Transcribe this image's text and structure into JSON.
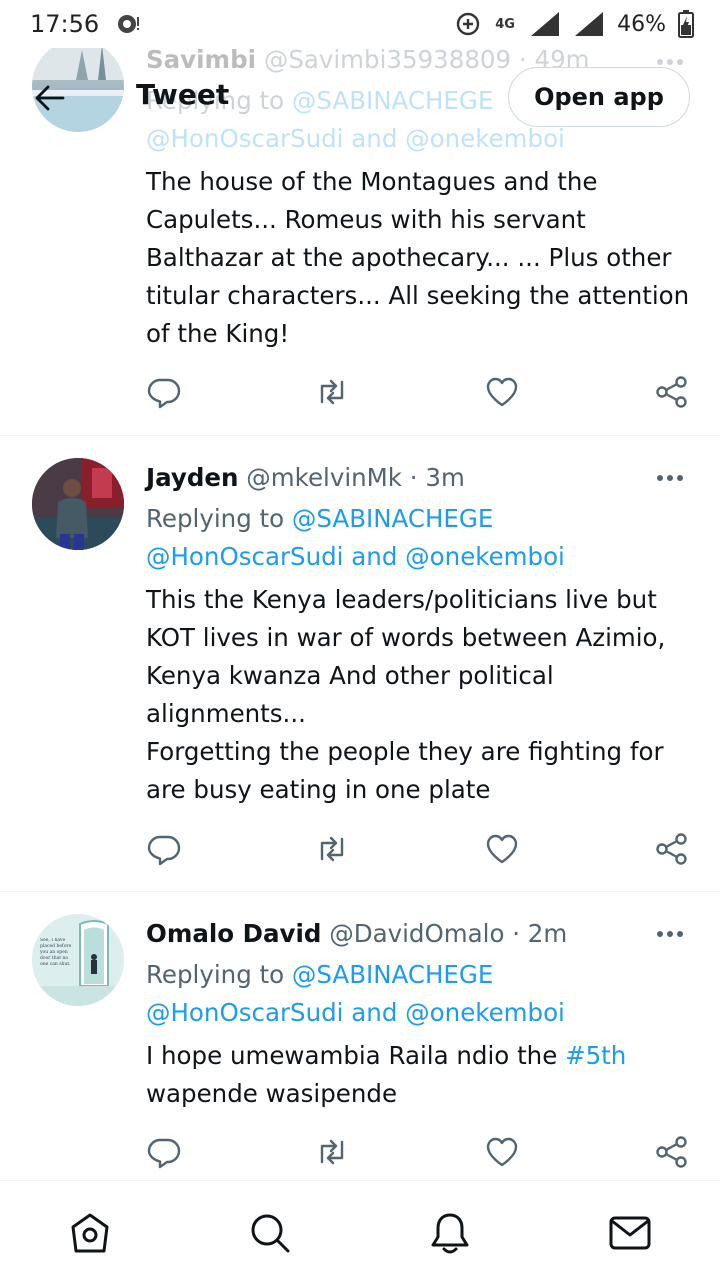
{
  "status_bar": {
    "time": "17:56",
    "network": "4G",
    "battery": "46%"
  },
  "header": {
    "title": "Tweet",
    "open_app_label": "Open app"
  },
  "colors": {
    "link": "#1d9bf0",
    "text": "#0f1419",
    "muted": "#536471",
    "divider": "#eff3f4"
  },
  "tweets": [
    {
      "name": "Savimbi",
      "handle": "@Savimbi35938809",
      "time": "· 49m",
      "replying_prefix": "Replying to",
      "reply_to": "@SABINACHEGE",
      "reply_more_1": "@HonOscarSudi",
      "reply_and": "and",
      "reply_more_2": "@onekemboi",
      "text": "The house of the Montagues and the Capulets... Romeus with his servant Balthazar at the apothecary... ... Plus other titular characters... All seeking the attention of the King!"
    },
    {
      "name": "Jayden",
      "handle": "@mkelvinMk",
      "time": "· 3m",
      "replying_prefix": "Replying to",
      "reply_to": "@SABINACHEGE",
      "reply_more_1": "@HonOscarSudi",
      "reply_and": "and",
      "reply_more_2": "@onekemboi",
      "text": "This the Kenya leaders/politicians live but KOT lives in war of words between Azimio, Kenya kwanza And other political alignments...\nForgetting the people they are fighting for are busy eating in one plate"
    },
    {
      "name": "Omalo David",
      "handle": "@DavidOmalo",
      "time": "· 2m",
      "replying_prefix": "Replying to",
      "reply_to": "@SABINACHEGE",
      "reply_more_1": "@HonOscarSudi",
      "reply_and": "and",
      "reply_more_2": "@onekemboi",
      "text_before": "I hope umewambia Raila ndio the ",
      "hashtag": "#5th",
      "text_after": "wapende wasipende",
      "avatar_text": "See, I have placed before you an open door that no one can shut."
    }
  ],
  "icons": {
    "reply": "reply-icon",
    "retweet": "retweet-icon",
    "like": "heart-icon",
    "share": "share-icon",
    "more": "more-icon"
  },
  "bottom_nav": [
    "home-icon",
    "search-icon",
    "notifications-icon",
    "messages-icon"
  ]
}
